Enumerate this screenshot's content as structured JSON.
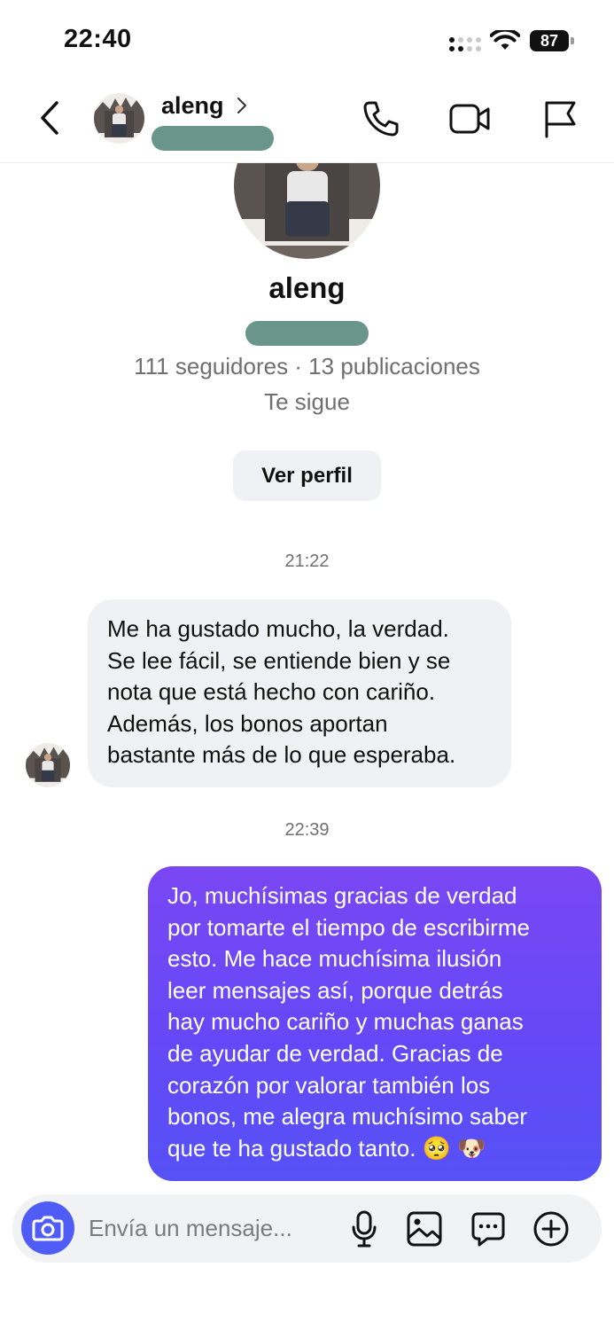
{
  "status_bar": {
    "time": "22:40",
    "battery": "87"
  },
  "header": {
    "username": "aleng"
  },
  "profile": {
    "name": "aleng",
    "stats": "111 seguidores · 13 publicaciones",
    "follow_status": "Te sigue",
    "view_profile_label": "Ver perfil"
  },
  "messages": [
    {
      "time": "21:22",
      "direction": "incoming",
      "text": "Me ha gustado mucho, la verdad. Se lee fácil, se entiende bien y se nota que está hecho con cariño. Además, los bonos aportan bastante más de lo que esperaba.",
      "lines": [
        "Me ha gustado mucho, la verdad.",
        "Se lee fácil, se entiende bien y se",
        "nota que está hecho con cariño.",
        "Además, los bonos aportan",
        "bastante más de lo que esperaba."
      ]
    },
    {
      "time": "22:39",
      "direction": "outgoing",
      "text": "Jo, muchísimas gracias de verdad por tomarte el tiempo de escribirme esto. Me hace muchísima ilusión leer mensajes así, porque detrás hay mucho cariño y muchas ganas de ayudar de verdad. Gracias de corazón por valorar también los bonos, me alegra muchísimo saber que te ha gustado tanto. 🥺 🐶",
      "lines": [
        "Jo, muchísimas gracias de verdad",
        "por tomarte el tiempo de escribirme",
        "esto. Me hace muchísima ilusión",
        "leer mensajes así, porque detrás",
        "hay mucho cariño y muchas ganas",
        "de ayudar de verdad. Gracias de",
        "corazón por valorar también los",
        "bonos, me alegra muchísimo saber",
        "que te ha gustado tanto. 🥺 🐶"
      ]
    }
  ],
  "composer": {
    "placeholder": "Envía un mensaje...",
    "value": ""
  },
  "colors": {
    "outgoing_bubble_top": "#7a47f3",
    "outgoing_bubble_bottom": "#5552f6",
    "incoming_bubble": "#eff1f4",
    "camera_button": "#4f5cf5",
    "redaction": "#6a958a",
    "secondary_text": "#6f6f6f"
  },
  "icons": {
    "header": [
      "back-icon",
      "chevron-right-icon",
      "phone-icon",
      "video-camera-icon",
      "flag-icon"
    ],
    "composer": [
      "camera-icon",
      "microphone-icon",
      "gallery-icon",
      "sticker-icon",
      "plus-icon"
    ]
  }
}
